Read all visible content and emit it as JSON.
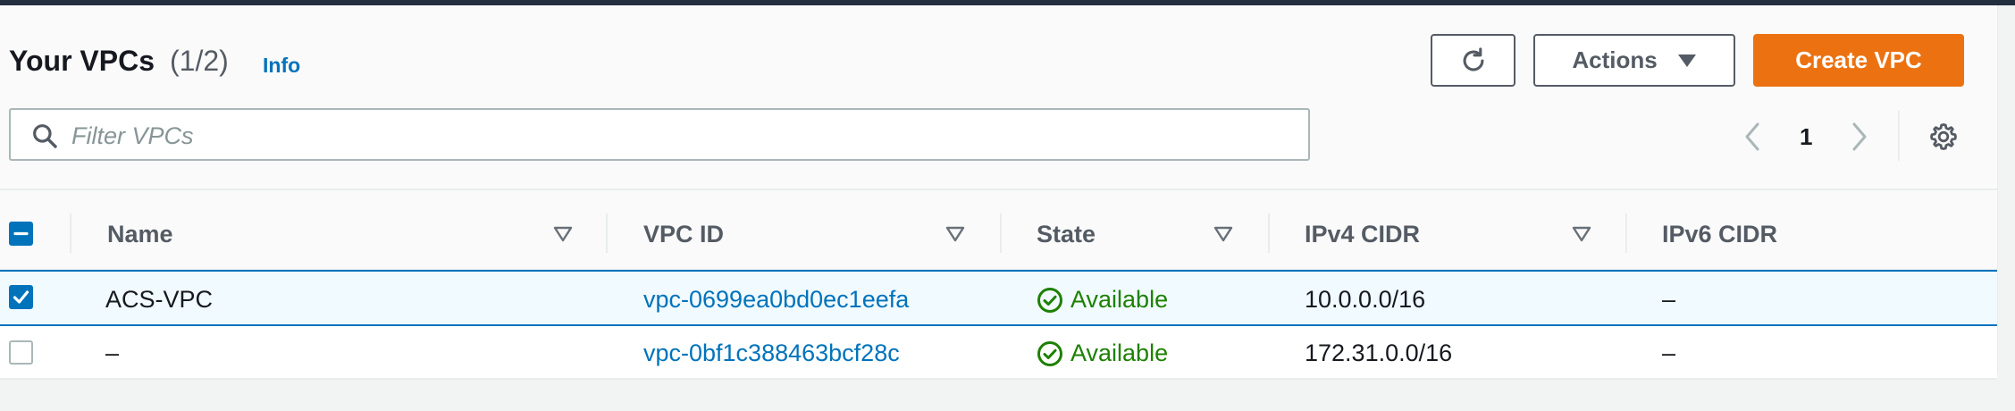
{
  "header": {
    "title": "Your VPCs",
    "count": "(1/2)",
    "info_link": "Info",
    "refresh_icon": "refresh-icon",
    "actions_label": "Actions",
    "create_label": "Create VPC"
  },
  "search": {
    "placeholder": "Filter VPCs",
    "value": ""
  },
  "pagination": {
    "current_page": "1"
  },
  "table": {
    "columns": [
      "Name",
      "VPC ID",
      "State",
      "IPv4 CIDR",
      "IPv6 CIDR"
    ],
    "rows": [
      {
        "selected": true,
        "name": "ACS-VPC",
        "vpc_id": "vpc-0699ea0bd0ec1eefa",
        "state": "Available",
        "ipv4": "10.0.0.0/16",
        "ipv6": "–"
      },
      {
        "selected": false,
        "name": "–",
        "vpc_id": "vpc-0bf1c388463bcf28c",
        "state": "Available",
        "ipv4": "172.31.0.0/16",
        "ipv6": "–"
      }
    ]
  },
  "colors": {
    "accent": "#0073bb",
    "primary_button": "#ec7211",
    "success": "#1d8102",
    "topbar": "#232f3e"
  }
}
